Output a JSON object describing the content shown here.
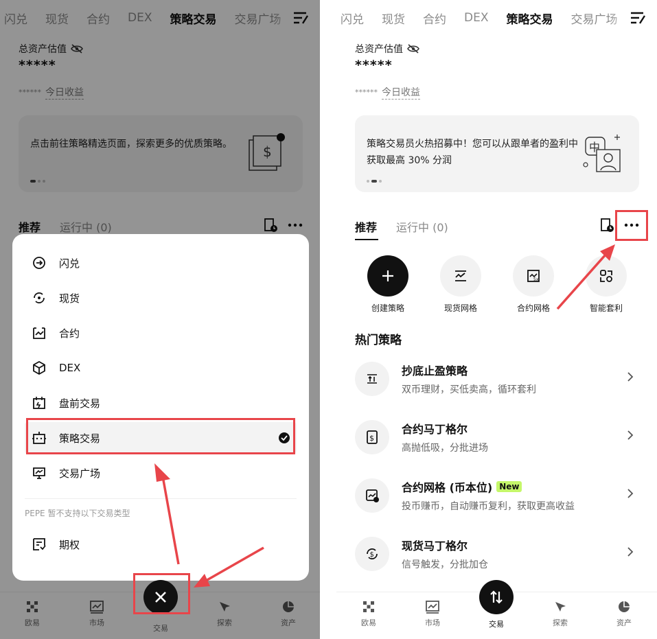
{
  "left": {
    "tabs": [
      "闪兑",
      "现货",
      "合约",
      "DEX",
      "策略交易",
      "交易广场"
    ],
    "active_tab": "策略交易",
    "asset_label": "总资产估值",
    "asset_value": "*****",
    "pnl_mask": "******",
    "pnl_label": "今日收益",
    "banner_text": "点击前往策略精选页面，探索更多的优质策略。",
    "subtabs": [
      "推荐",
      "运行中 (0)"
    ],
    "sheet": {
      "items": [
        {
          "label": "闪兑",
          "icon": "swap-icon"
        },
        {
          "label": "现货",
          "icon": "spot-icon"
        },
        {
          "label": "合约",
          "icon": "contract-icon"
        },
        {
          "label": "DEX",
          "icon": "dex-icon"
        },
        {
          "label": "盘前交易",
          "icon": "premarket-icon"
        },
        {
          "label": "策略交易",
          "icon": "bot-icon",
          "selected": true
        },
        {
          "label": "交易广场",
          "icon": "square-icon"
        }
      ],
      "note": "PEPE 暂不支持以下交易类型",
      "extra_items": [
        {
          "label": "期权",
          "icon": "options-icon"
        }
      ]
    },
    "bottom_nav": [
      "欧易",
      "市场",
      "交易",
      "探索",
      "资产"
    ]
  },
  "right": {
    "tabs": [
      "闪兑",
      "现货",
      "合约",
      "DEX",
      "策略交易",
      "交易广场"
    ],
    "active_tab": "策略交易",
    "asset_label": "总资产估值",
    "asset_value": "*****",
    "pnl_mask": "******",
    "pnl_label": "今日收益",
    "banner_text": "策略交易员火热招募中！您可以从跟单者的盈利中获取最高 30% 分润",
    "subtabs": [
      "推荐",
      "运行中 (0)"
    ],
    "strategies": [
      "创建策略",
      "现货网格",
      "合约网格",
      "智能套利"
    ],
    "hot_title": "热门策略",
    "hot_items": [
      {
        "title": "抄底止盈策略",
        "sub": "双币理财，买低卖高，循环套利",
        "badge": ""
      },
      {
        "title": "合约马丁格尔",
        "sub": "高抛低吸，分批进场",
        "badge": ""
      },
      {
        "title": "合约网格 (币本位)",
        "sub": "投币赚币，自动赚币复利，获取更高收益",
        "badge": "New"
      },
      {
        "title": "现货马丁格尔",
        "sub": "信号触发，分批加仓",
        "badge": ""
      }
    ],
    "bottom_nav": [
      "欧易",
      "市场",
      "交易",
      "探索",
      "资产"
    ]
  },
  "colors": {
    "highlight": "#e8454a",
    "new_badge": "#c5f76a",
    "dark": "#111111"
  }
}
